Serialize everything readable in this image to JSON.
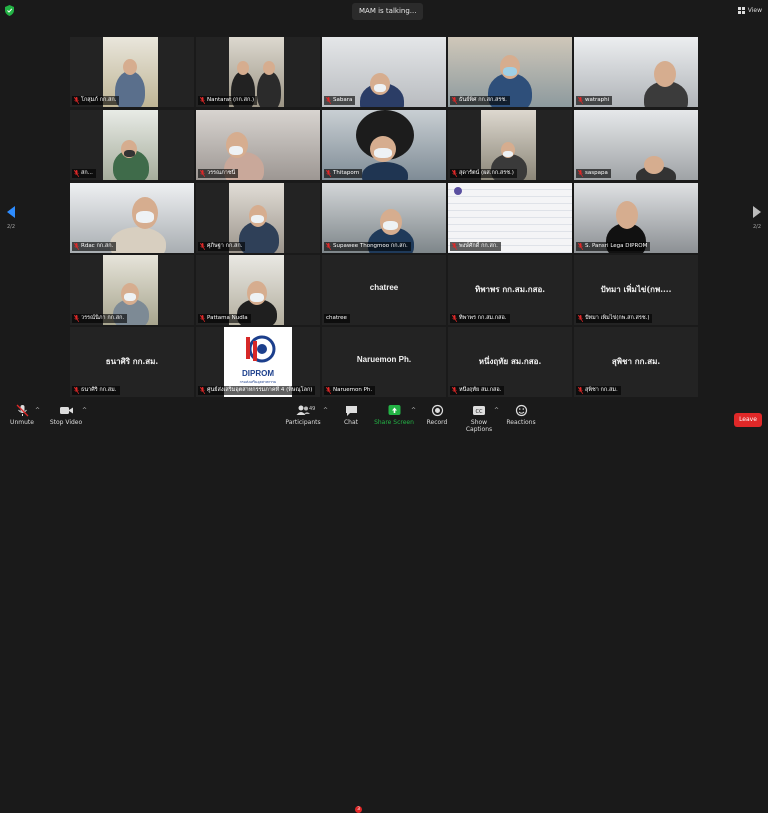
{
  "topbar": {
    "speaking": "MAM is talking...",
    "view_label": "View"
  },
  "pagination": {
    "prev": "2/2",
    "next": "2/2"
  },
  "tiles": [
    {
      "name": "โกสุมภ์ กก.สก."
    },
    {
      "name": "Nantarat (กก.สก.)"
    },
    {
      "name": "Sabara"
    },
    {
      "name": "ธันย์พิศ กก.สก.สรช."
    },
    {
      "name": "watraphi"
    },
    {
      "name": "สก..."
    },
    {
      "name": "วรรณภาชนิ์"
    },
    {
      "name": "Thitaporn"
    },
    {
      "name": "สุดารัตน์ (ผส.กก.สรช.)"
    },
    {
      "name": "saspapa"
    },
    {
      "name": "Rdac กก.สก."
    },
    {
      "name": "ศุภิษฐา กก.สก."
    },
    {
      "name": "Supawee Thongmoo กก.สก."
    },
    {
      "name": "พงษ์ศักดิ์ กก.สก."
    },
    {
      "name": "S. Pansri Lega DIPROM"
    },
    {
      "name": "วรรณ์นิภา กก.สก."
    },
    {
      "name": "Pattama Nudla"
    },
    {
      "name": "chatree",
      "big": "chatree"
    },
    {
      "name": "ทิพาพร กก.สม.กสอ.",
      "big": "ทิพาพร กก.สม.กสอ."
    },
    {
      "name": "ปัทมา เพิ่มไข่(กพ.สก.สรช.)",
      "big": "ปัทมา เพิ่มไข่(กพ...."
    },
    {
      "name": "ธนาศิริ กก.สม.",
      "big": "ธนาศิริ กก.สม."
    },
    {
      "name": "ศูนย์ส่งเสริมอุตสาหกรรมภาคที่ 4 (พิษณุโลก)",
      "logo": "DIPROM",
      "logo_sub": "กรมส่งเสริมอุตสาหกรรม"
    },
    {
      "name": "Naruemon Ph.",
      "big": "Naruemon Ph."
    },
    {
      "name": "หนึ่งฤทัย สม.กสอ.",
      "big": "หนึ่งฤทัย สม.กสอ."
    },
    {
      "name": "สุพิชา กก.สม.",
      "big": "สุพิชา กก.สม."
    }
  ],
  "toolbar": {
    "unmute": "Unmute",
    "stop_video": "Stop Video",
    "participants": "Participants",
    "participants_count": "49",
    "chat": "Chat",
    "chat_badge": "3",
    "share_screen": "Share Screen",
    "record": "Record",
    "captions": "Show Captions",
    "reactions": "Reactions",
    "leave": "Leave"
  },
  "colors": {
    "accent": "#2d8cff",
    "share_green": "#23b345",
    "leave_red": "#e02828",
    "mute_red": "#e02828"
  }
}
